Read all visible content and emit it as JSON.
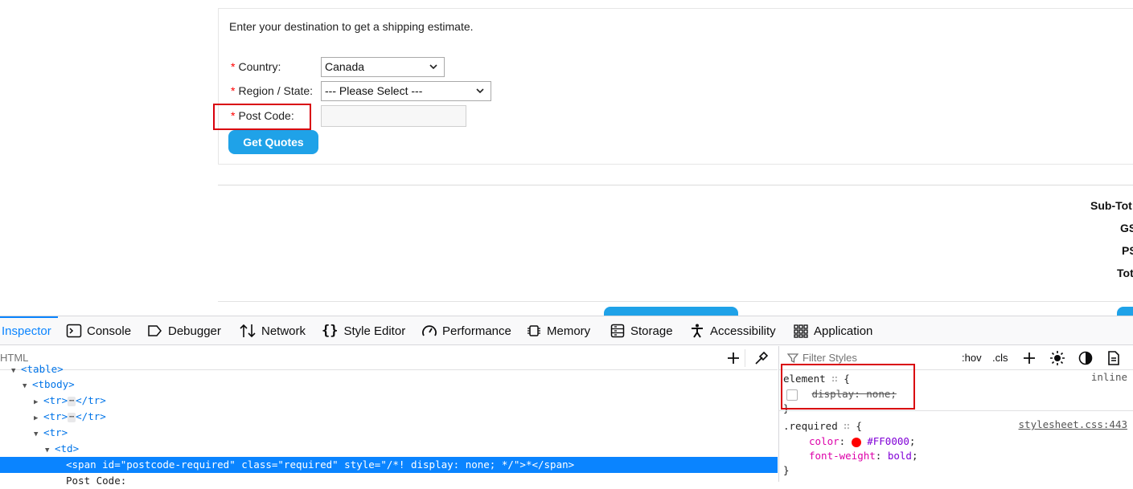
{
  "page": {
    "intro_text": "Enter your destination to get a shipping estimate.",
    "required_mark": "*",
    "country": {
      "label": "Country:",
      "value": "Canada"
    },
    "region": {
      "label": "Region / State:",
      "value": "--- Please Select ---"
    },
    "postcode": {
      "label": "Post Code:",
      "value": ""
    },
    "quote_button": "Get Quotes",
    "totals": [
      "Sub-Tot",
      "GS",
      "PS",
      "Tot"
    ]
  },
  "devtools": {
    "tabs": [
      {
        "label": "Inspector",
        "icon": "inspector-icon",
        "active": true
      },
      {
        "label": "Console",
        "icon": "console-icon"
      },
      {
        "label": "Debugger",
        "icon": "debugger-icon"
      },
      {
        "label": "Network",
        "icon": "network-icon"
      },
      {
        "label": "Style Editor",
        "icon": "braces-icon"
      },
      {
        "label": "Performance",
        "icon": "gauge-icon"
      },
      {
        "label": "Memory",
        "icon": "chip-icon"
      },
      {
        "label": "Storage",
        "icon": "storage-icon"
      },
      {
        "label": "Accessibility",
        "icon": "accessibility-icon"
      },
      {
        "label": "Application",
        "icon": "grid-icon"
      }
    ],
    "html_search_placeholder": "HTML",
    "tree": {
      "table": "<table>",
      "tbody": "<tbody>",
      "tr_collapsed_1": [
        "<tr>",
        "⋯",
        "</tr>"
      ],
      "tr_collapsed_2": [
        "<tr>",
        "⋯",
        "</tr>"
      ],
      "tr_open": "<tr>",
      "td_open": "<td>",
      "selected": "<span id=\"postcode-required\" class=\"required\" style=\"/*! display: none; */\">*</span>",
      "text_node": "Post Code:"
    },
    "styles": {
      "filter_placeholder": "Filter Styles",
      "hov": ":hov",
      "cls": ".cls",
      "rule1": {
        "selector": "element",
        "brace_open": "{",
        "source": "inline",
        "declaration_text": "display: none;",
        "brace_close": "}"
      },
      "rule2": {
        "selector": ".required",
        "brace_open": "{",
        "source": "stylesheet.css:443",
        "prop1": "color",
        "val1": "#FF0000",
        "prop2": "font-weight",
        "val2": "bold",
        "brace_close": "}",
        "swatch_color": "#FF0000"
      }
    }
  },
  "colors": {
    "accent": "#0a84ff",
    "button": "#1fa2e8",
    "highlight": "#d9000d",
    "required": "#ff0000"
  }
}
